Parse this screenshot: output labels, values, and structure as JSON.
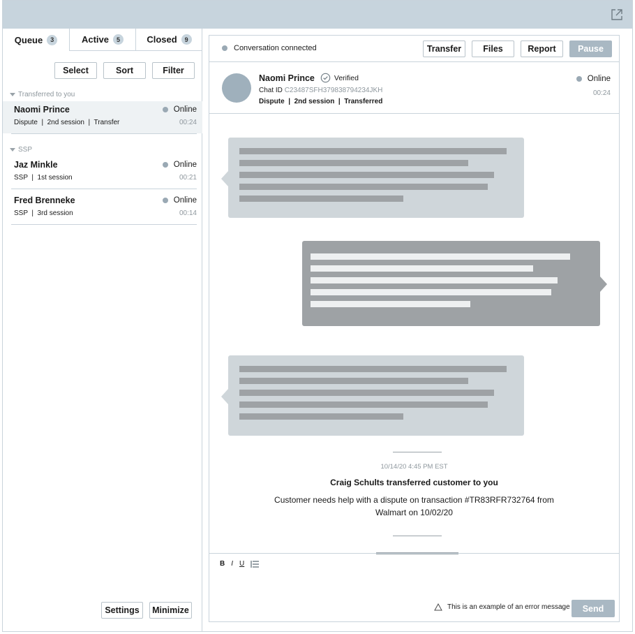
{
  "queue": {
    "tabs": [
      {
        "label": "Queue",
        "count": "3"
      },
      {
        "label": "Active",
        "count": "5"
      },
      {
        "label": "Closed",
        "count": "9"
      }
    ],
    "tools": {
      "select": "Select",
      "sort": "Sort",
      "filter": "Filter"
    },
    "groups": [
      {
        "title": "Transferred to you",
        "items": [
          {
            "name": "Naomi Prince",
            "status": "Online",
            "meta": "Dispute  |  2nd session  |  Transfer",
            "time": "00:24"
          }
        ]
      },
      {
        "title": "SSP",
        "items": [
          {
            "name": "Jaz Minkle",
            "status": "Online",
            "meta": "SSP  |  1st session",
            "time": "00:21"
          },
          {
            "name": "Fred Brenneke",
            "status": "Online",
            "meta": "SSP  |  3rd session",
            "time": "00:14"
          }
        ]
      }
    ],
    "footer": {
      "settings": "Settings",
      "minimize": "Minimize"
    }
  },
  "conversation": {
    "status_text": "Conversation connected",
    "actions": {
      "transfer": "Transfer",
      "files": "Files",
      "report": "Report",
      "pause": "Pause"
    },
    "customer": {
      "name": "Naomi Prince",
      "verified": "Verified",
      "chat_id_label": "Chat ID",
      "chat_id": "C23487SFH379838794234JKH",
      "tags": "Dispute  |  2nd session  |  Transferred",
      "status": "Online",
      "time": "00:24"
    },
    "system_message": {
      "timestamp": "10/14/20 4:45 PM EST",
      "title": "Craig Schults transferred customer to you",
      "body": "Customer needs help with a dispute on transaction #TR83RFR732764 from Walmart on 10/02/20"
    }
  },
  "composer": {
    "format": {
      "bold": "B",
      "italic": "I",
      "underline": "U"
    },
    "error": "This is an example of an error message",
    "send": "Send"
  },
  "colors": {
    "topbar": "#c7d4dd",
    "disabled_button": "#a9b8c3",
    "status_dot": "#9aa9b4",
    "incoming_bubble": "#cfd6da",
    "outgoing_bubble": "#9ea2a5"
  }
}
